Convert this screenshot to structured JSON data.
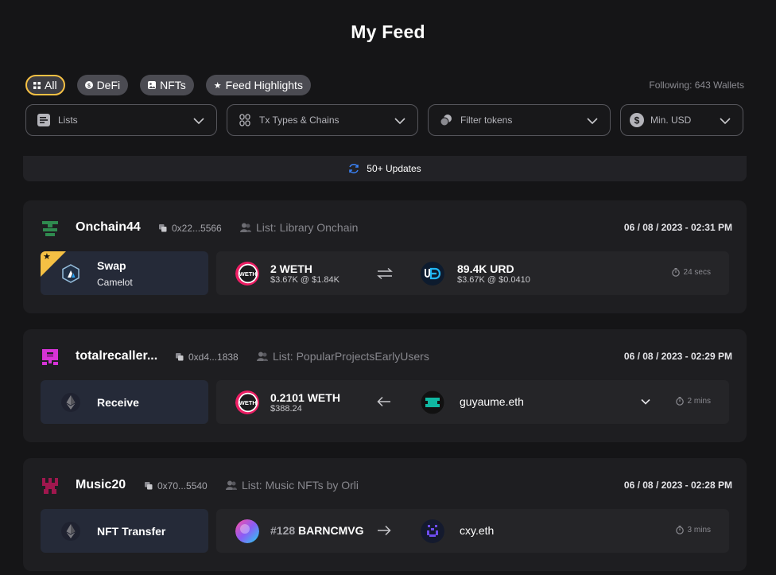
{
  "page": {
    "title": "My Feed",
    "following": "Following: 643 Wallets"
  },
  "chips": [
    {
      "label": "All",
      "icon": "grid-icon",
      "active": true
    },
    {
      "label": "DeFi",
      "icon": "defi-icon",
      "active": false
    },
    {
      "label": "NFTs",
      "icon": "nft-icon",
      "active": false
    },
    {
      "label": "Feed Highlights",
      "icon": "star-icon",
      "active": false
    }
  ],
  "filters": {
    "lists": "Lists",
    "tx_types": "Tx Types & Chains",
    "tokens": "Filter tokens",
    "min_usd": "Min. USD"
  },
  "updates": {
    "label": "50+ Updates"
  },
  "colors": {
    "accent": "#f5c044",
    "card": "#1e1e21",
    "tx_box": "#252a38",
    "updates_icon": "#3b82f6"
  },
  "feed": [
    {
      "name": "Onchain44",
      "address": "0x22...5566",
      "list": "List: Library Onchain",
      "date": "06 / 08 / 2023 - 02:31 PM",
      "tx_type": "Swap",
      "protocol": "Camelot",
      "highlighted": true,
      "from_amount": "2 WETH",
      "from_sub": "$3.67K @ $1.84K",
      "to_amount": "89.4K URD",
      "to_sub": "$3.67K @ $0.0410",
      "time": "24 secs"
    },
    {
      "name": "totalrecaller...",
      "address": "0xd4...1838",
      "list": "List: PopularProjectsEarlyUsers",
      "date": "06 / 08 / 2023 - 02:29 PM",
      "tx_type": "Receive",
      "highlighted": false,
      "from_amount": "0.2101 WETH",
      "from_sub": "$388.24",
      "counterparty": "guyaume.eth",
      "time": "2 mins"
    },
    {
      "name": "Music20",
      "address": "0x70...5540",
      "list": "List: Music NFTs by Orli",
      "date": "06 / 08 / 2023 - 02:28 PM",
      "tx_type": "NFT Transfer",
      "highlighted": false,
      "nft_id": "#128",
      "nft_name": "BARNCMVG",
      "counterparty": "cxy.eth",
      "time": "3 mins"
    }
  ]
}
